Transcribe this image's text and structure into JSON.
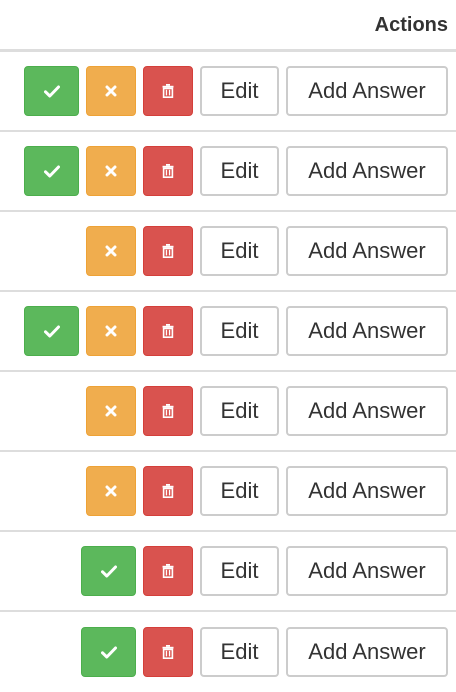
{
  "table": {
    "header": {
      "actions_label": "Actions"
    },
    "rows": [
      {
        "approve": true,
        "reject": true,
        "delete": true,
        "edit_label": "Edit",
        "add_answer_label": "Add Answer"
      },
      {
        "approve": true,
        "reject": true,
        "delete": true,
        "edit_label": "Edit",
        "add_answer_label": "Add Answer"
      },
      {
        "approve": false,
        "reject": true,
        "delete": true,
        "edit_label": "Edit",
        "add_answer_label": "Add Answer"
      },
      {
        "approve": true,
        "reject": true,
        "delete": true,
        "edit_label": "Edit",
        "add_answer_label": "Add Answer"
      },
      {
        "approve": false,
        "reject": true,
        "delete": true,
        "edit_label": "Edit",
        "add_answer_label": "Add Answer"
      },
      {
        "approve": false,
        "reject": true,
        "delete": true,
        "edit_label": "Edit",
        "add_answer_label": "Add Answer"
      },
      {
        "approve": true,
        "reject": false,
        "delete": true,
        "edit_label": "Edit",
        "add_answer_label": "Add Answer"
      },
      {
        "approve": true,
        "reject": false,
        "delete": true,
        "edit_label": "Edit",
        "add_answer_label": "Add Answer"
      }
    ]
  },
  "icons": {
    "approve": "check-icon",
    "reject": "close-icon",
    "delete": "trash-icon"
  },
  "colors": {
    "approve": "#5cb85c",
    "reject": "#f0ad4e",
    "delete": "#d9534f",
    "border": "#cccccc",
    "divider": "#dddddd",
    "text": "#333333"
  }
}
